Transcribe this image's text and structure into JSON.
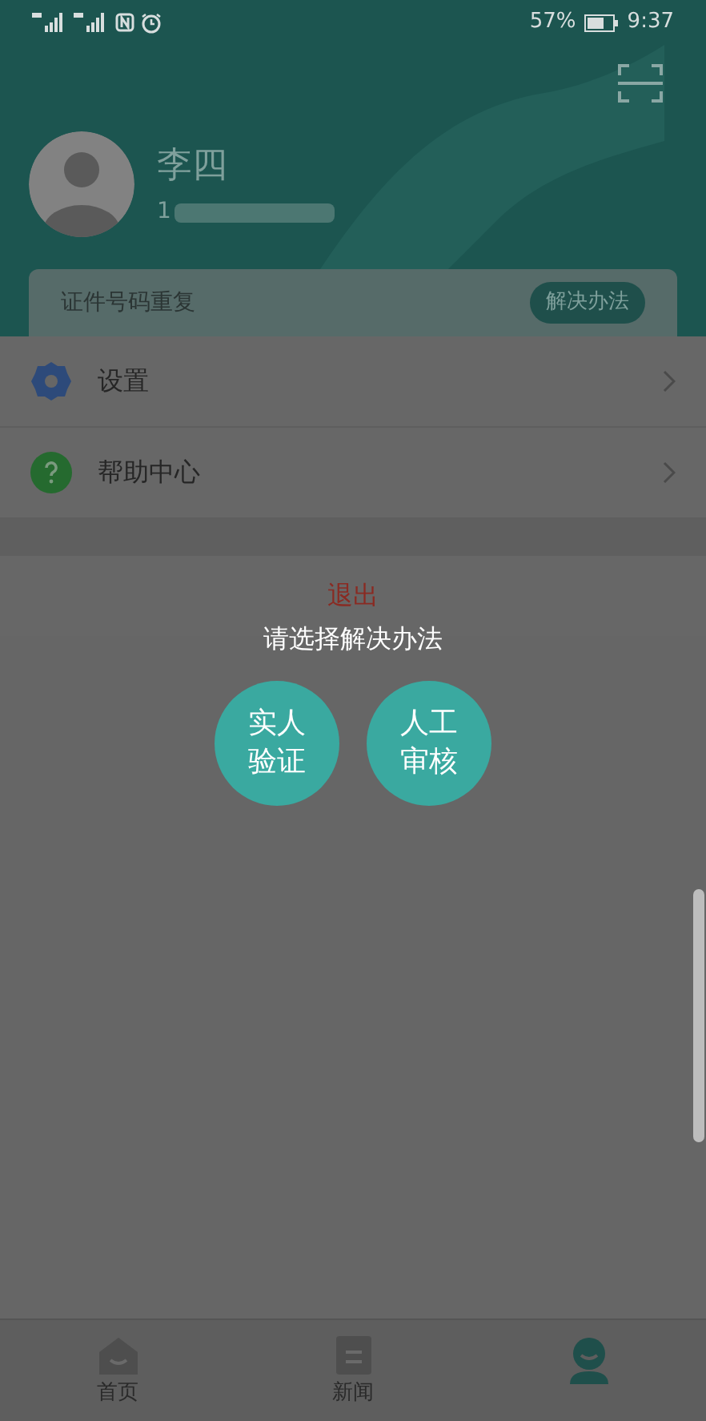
{
  "status_bar": {
    "battery": "57%",
    "time": "9:37"
  },
  "profile": {
    "name": "李四",
    "phone": "1"
  },
  "notice": {
    "text": "证件号码重复",
    "button": "解决办法"
  },
  "menu": [
    {
      "kind": "settings",
      "label": "设置"
    },
    {
      "kind": "help",
      "label": "帮助中心"
    }
  ],
  "logout": "退出",
  "dialog": {
    "prompt": "请选择解决办法",
    "options": [
      {
        "lines": [
          "实人",
          "验证"
        ]
      },
      {
        "lines": [
          "人工",
          "审核"
        ]
      }
    ]
  },
  "bottom_nav": [
    {
      "kind": "home",
      "label": "首页",
      "selected": false
    },
    {
      "kind": "news",
      "label": "新闻",
      "selected": false
    },
    {
      "kind": "me",
      "selected": true
    }
  ]
}
